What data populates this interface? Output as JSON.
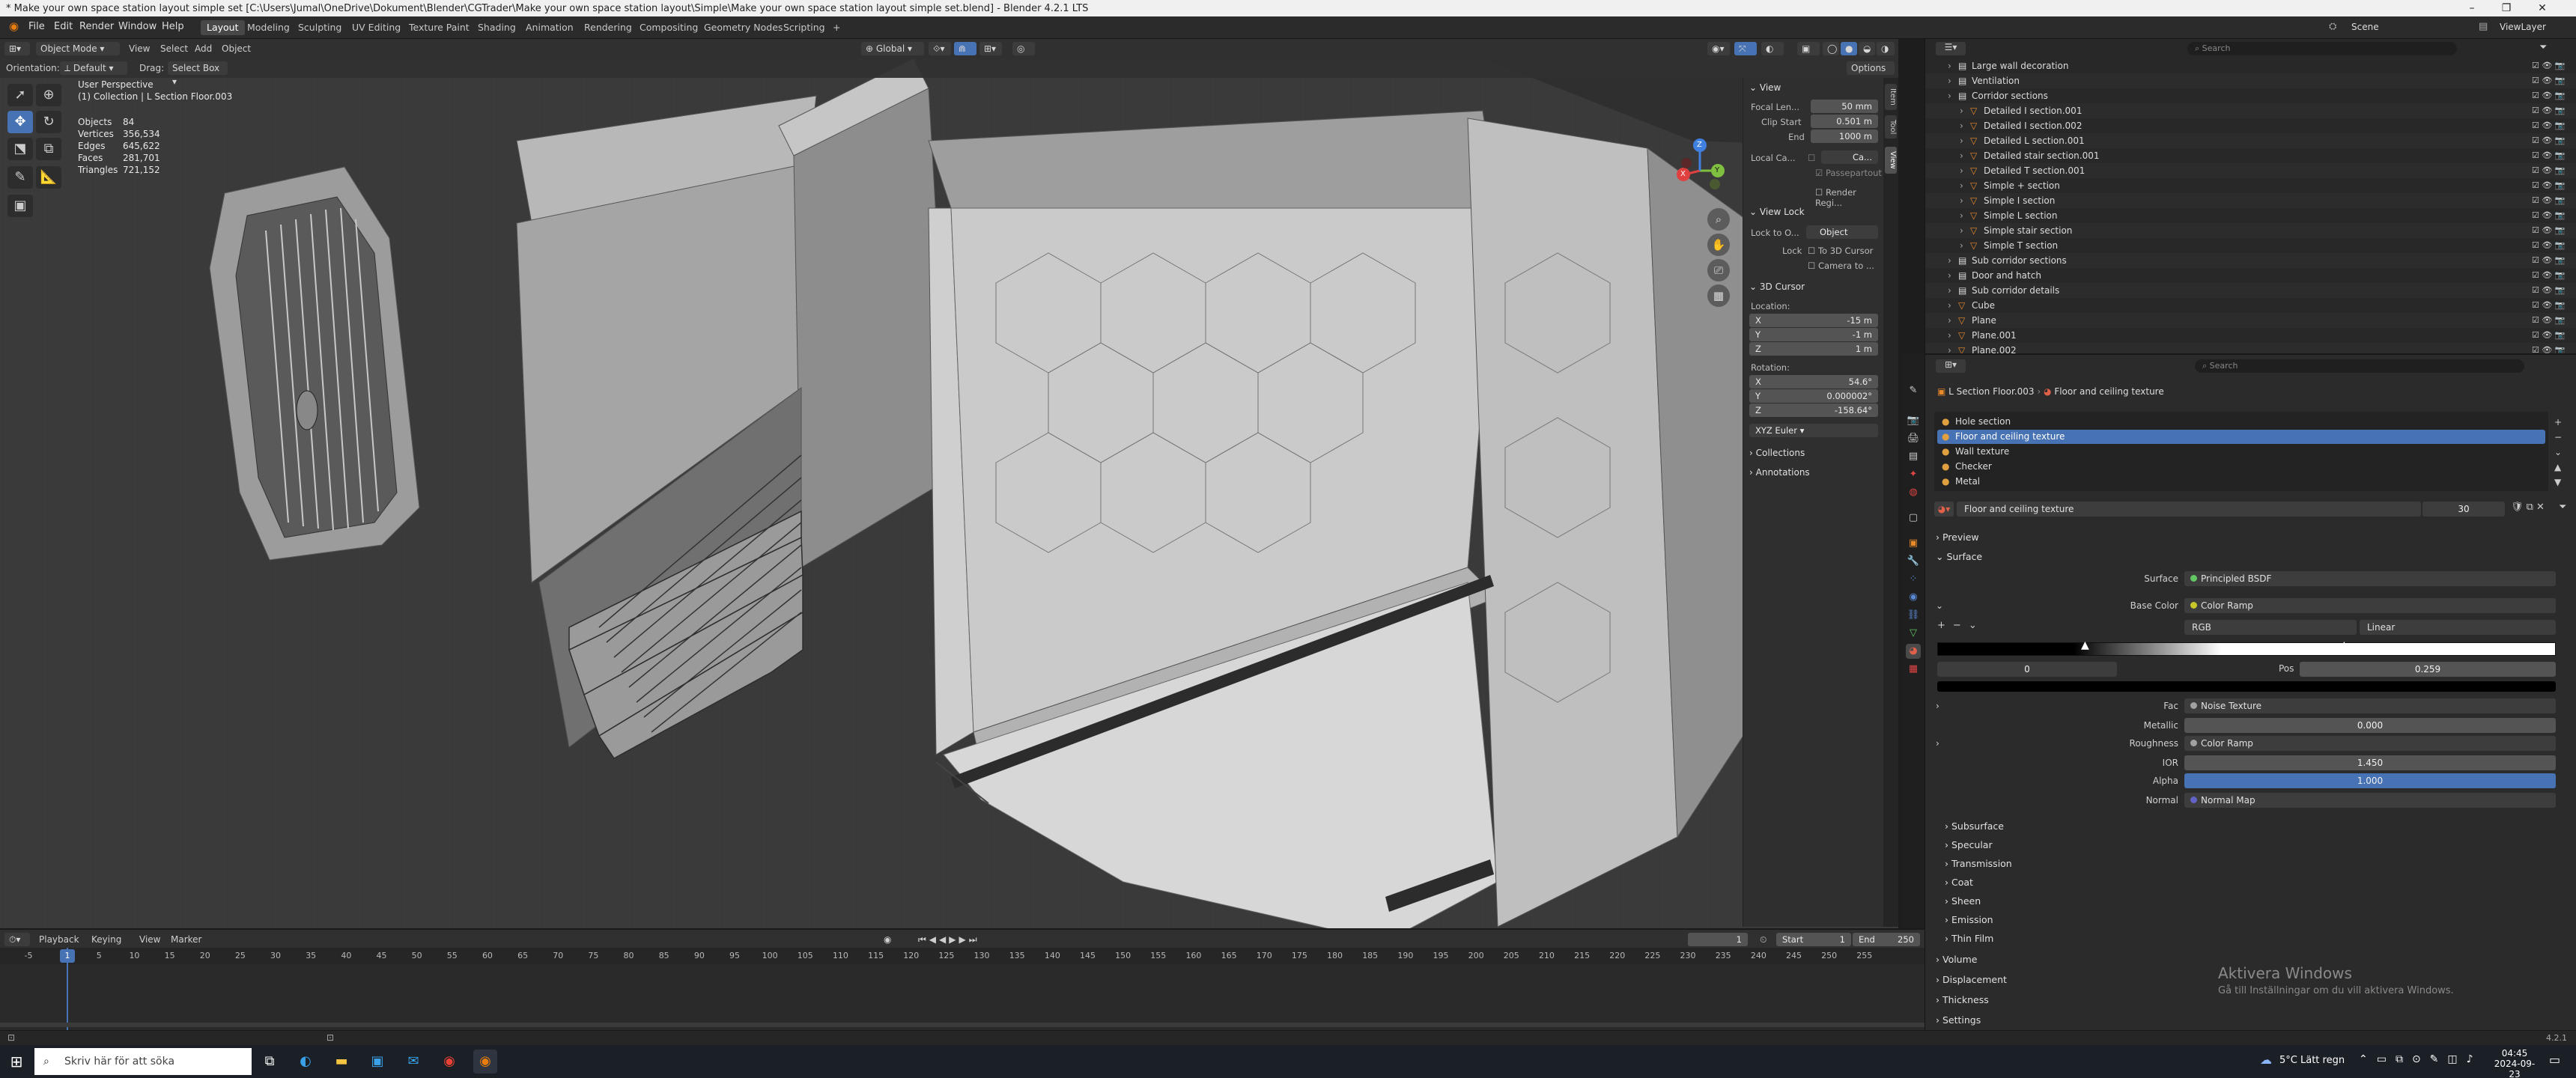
{
  "window": {
    "title": "* Make your own space station layout simple set [C:\\Users\\Jumal\\OneDrive\\Dokument\\Blender\\CGTrader\\Make your own space station layout\\Simple\\Make your own space station layout simple set.blend] - Blender 4.2.1 LTS",
    "controls": [
      "–",
      "❐",
      "✕"
    ]
  },
  "topbar": {
    "menus": [
      "File",
      "Edit",
      "Render",
      "Window",
      "Help"
    ],
    "workspaces": [
      "Layout",
      "Modeling",
      "Sculpting",
      "UV Editing",
      "Texture Paint",
      "Shading",
      "Animation",
      "Rendering",
      "Compositing",
      "Geometry Nodes",
      "Scripting"
    ],
    "active_workspace": "Layout",
    "add_tab": "+",
    "scene": "Scene",
    "view_layer": "ViewLayer"
  },
  "viewport_header": {
    "mode": "Object Mode",
    "menus": [
      "View",
      "Select",
      "Add",
      "Object"
    ],
    "orientation_label": "Orientation:",
    "orientation_value": "Default",
    "drag_label": "Drag:",
    "drag_value": "Select Box",
    "transform_orientation": "Global",
    "options": "Options"
  },
  "viewport": {
    "perspective": "User Perspective",
    "collection_line": "(1) Collection | L Section Floor.003",
    "stats": [
      {
        "label": "Objects",
        "value": "84"
      },
      {
        "label": "Vertices",
        "value": "356,534"
      },
      {
        "label": "Edges",
        "value": "645,622"
      },
      {
        "label": "Faces",
        "value": "281,701"
      },
      {
        "label": "Triangles",
        "value": "721,152"
      }
    ],
    "gizmo": {
      "x": "X",
      "y": "Y",
      "z": "Z"
    }
  },
  "npanel": {
    "tabs": [
      "Item",
      "Tool",
      "View"
    ],
    "view_header": "View",
    "focal_label": "Focal Len...",
    "focal_value": "50 mm",
    "clip_start_label": "Clip Start",
    "clip_start_value": "0.501 m",
    "end_label": "End",
    "end_value": "1000 m",
    "local_camera_label": "Local Ca...",
    "local_camera_value": "Ca...",
    "passepartout": "Passepartout",
    "render_region": "Render Regi...",
    "view_lock_header": "View Lock",
    "lock_to_object_label": "Lock to O...",
    "lock_to_object_value": "Object",
    "lock_label": "Lock",
    "to_3d_cursor": "To 3D Cursor",
    "camera_to": "Camera to ...",
    "cursor_header": "3D Cursor",
    "location_label": "Location:",
    "loc_x": "-15 m",
    "loc_y": "-1 m",
    "loc_z": "1 m",
    "rotation_label": "Rotation:",
    "rot_x": "54.6°",
    "rot_y": "0.000002°",
    "rot_z": "-158.64°",
    "rotation_mode": "XYZ Euler",
    "collections": "Collections",
    "annotations": "Annotations",
    "axis_x": "X",
    "axis_y": "Y",
    "axis_z": "Z"
  },
  "outliner": {
    "search_placeholder": "Search",
    "rows": [
      {
        "name": "Large wall decoration",
        "indent": 1
      },
      {
        "name": "Ventilation",
        "indent": 1
      },
      {
        "name": "Corridor sections",
        "indent": 1
      },
      {
        "name": "Detailed I section.001",
        "indent": 2
      },
      {
        "name": "Detailed I section.002",
        "indent": 2
      },
      {
        "name": "Detailed L section.001",
        "indent": 2
      },
      {
        "name": "Detailed stair section.001",
        "indent": 2
      },
      {
        "name": "Detailed T section.001",
        "indent": 2
      },
      {
        "name": "Simple + section",
        "indent": 2
      },
      {
        "name": "Simple I section",
        "indent": 2
      },
      {
        "name": "Simple L section",
        "indent": 2
      },
      {
        "name": "Simple stair section",
        "indent": 2
      },
      {
        "name": "Simple T section",
        "indent": 2
      },
      {
        "name": "Sub corridor sections",
        "indent": 1
      },
      {
        "name": "Door and hatch",
        "indent": 1
      },
      {
        "name": "Sub corridor details",
        "indent": 1
      },
      {
        "name": "Cube",
        "indent": 1
      },
      {
        "name": "Plane",
        "indent": 1
      },
      {
        "name": "Plane.001",
        "indent": 1
      },
      {
        "name": "Plane.002",
        "indent": 1
      }
    ]
  },
  "properties": {
    "search_placeholder": "Search",
    "breadcrumb_object": "L Section Floor.003",
    "breadcrumb_material": "Floor and ceiling texture",
    "material_slots": [
      "Hole section",
      "Floor and ceiling texture",
      "Wall texture",
      "Checker",
      "Metal"
    ],
    "active_slot": "Floor and ceiling texture",
    "material_name": "Floor and ceiling texture",
    "users": "30",
    "preview": "Preview",
    "surface_header": "Surface",
    "surface_label": "Surface",
    "surface_value": "Principled BSDF",
    "base_color_label": "Base Color",
    "base_color_value": "Color Ramp",
    "ramp_mode": "RGB",
    "ramp_interp": "Linear",
    "ramp_index": "0",
    "ramp_pos_label": "Pos",
    "ramp_pos_value": "0.259",
    "fac_label": "Fac",
    "fac_value": "Noise Texture",
    "metallic_label": "Metallic",
    "metallic_value": "0.000",
    "roughness_label": "Roughness",
    "roughness_value": "Color Ramp",
    "ior_label": "IOR",
    "ior_value": "1.450",
    "alpha_label": "Alpha",
    "alpha_value": "1.000",
    "normal_label": "Normal",
    "normal_value": "Normal Map",
    "subpanels": [
      "Subsurface",
      "Specular",
      "Transmission",
      "Coat",
      "Sheen",
      "Emission",
      "Thin Film"
    ],
    "sections": [
      "Volume",
      "Displacement",
      "Thickness",
      "Settings"
    ]
  },
  "timeline": {
    "menus": [
      "Playback",
      "Keying",
      "View",
      "Marker"
    ],
    "current_frame": "1",
    "start_label": "Start",
    "start_value": "1",
    "end_label": "End",
    "end_value": "250",
    "ticks": [
      "-5",
      "0",
      "5",
      "10",
      "15",
      "20",
      "25",
      "30",
      "35",
      "40",
      "45",
      "50",
      "55",
      "60",
      "65",
      "70",
      "75",
      "80",
      "85",
      "90",
      "95",
      "100",
      "105",
      "110",
      "115",
      "120",
      "125",
      "130",
      "135",
      "140",
      "145",
      "150",
      "155",
      "160",
      "165",
      "170",
      "175",
      "180",
      "185",
      "190",
      "195",
      "200",
      "205",
      "210",
      "215",
      "220",
      "225",
      "230",
      "235",
      "240",
      "245",
      "250",
      "255"
    ],
    "playhead": "1"
  },
  "status": {
    "version": "4.2.1"
  },
  "activate_windows": {
    "title": "Aktivera Windows",
    "subtitle": "Gå till Inställningar om du vill aktivera Windows."
  },
  "taskbar": {
    "search_placeholder": "Skriv här för att söka",
    "weather": "5°C  Lätt regn",
    "time": "04:45",
    "date": "2024-09-23"
  }
}
